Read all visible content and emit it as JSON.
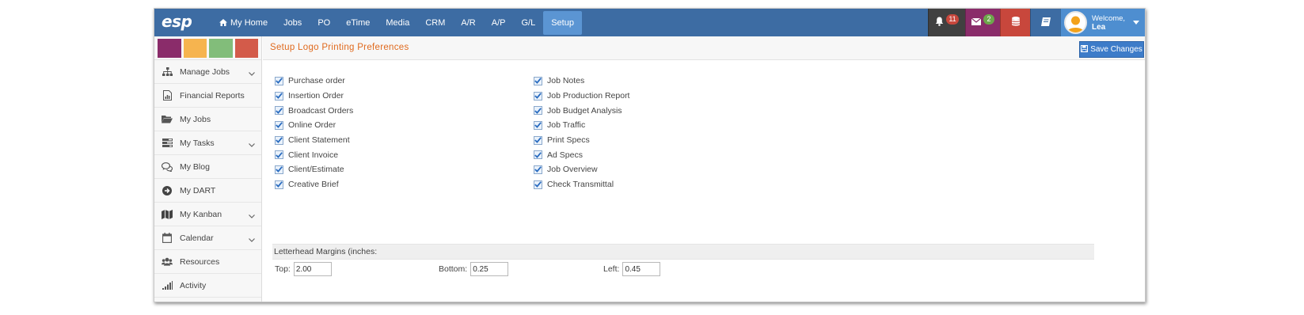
{
  "app": {
    "logo": "esp"
  },
  "nav": {
    "items": [
      {
        "label": "My Home"
      },
      {
        "label": "Jobs"
      },
      {
        "label": "PO"
      },
      {
        "label": "eTime"
      },
      {
        "label": "Media"
      },
      {
        "label": "CRM"
      },
      {
        "label": "A/R"
      },
      {
        "label": "A/P"
      },
      {
        "label": "G/L"
      },
      {
        "label": "Setup"
      }
    ],
    "active": "Setup"
  },
  "tools": {
    "notifications_count": "11",
    "messages_count": "2",
    "welcome": "Welcome,",
    "user_name": "Lea"
  },
  "colors": {
    "navbar": "#3d6ca3",
    "active_tab": "#5b95d3",
    "title": "#e06a1e",
    "swatches": [
      "#8a2c6a",
      "#f6b44f",
      "#82bd7a",
      "#d35b4a"
    ]
  },
  "sidebar": {
    "items": [
      {
        "label": "Manage Jobs",
        "icon": "sitemap-icon",
        "expandable": true
      },
      {
        "label": "Financial Reports",
        "icon": "report-icon",
        "expandable": false
      },
      {
        "label": "My Jobs",
        "icon": "folder-open-icon",
        "expandable": false
      },
      {
        "label": "My Tasks",
        "icon": "tasks-icon",
        "expandable": true
      },
      {
        "label": "My Blog",
        "icon": "comments-icon",
        "expandable": false
      },
      {
        "label": "My DART",
        "icon": "arrow-circle-icon",
        "expandable": false
      },
      {
        "label": "My Kanban",
        "icon": "map-icon",
        "expandable": true
      },
      {
        "label": "Calendar",
        "icon": "calendar-icon",
        "expandable": true
      },
      {
        "label": "Resources",
        "icon": "users-icon",
        "expandable": false
      },
      {
        "label": "Activity",
        "icon": "signal-icon",
        "expandable": false
      }
    ]
  },
  "page": {
    "title": "Setup Logo Printing Preferences",
    "save_label": "Save Changes"
  },
  "preferences": {
    "left": [
      {
        "label": "Purchase order",
        "checked": true
      },
      {
        "label": "Insertion Order",
        "checked": true
      },
      {
        "label": "Broadcast Orders",
        "checked": true
      },
      {
        "label": "Online Order",
        "checked": true
      },
      {
        "label": "Client Statement",
        "checked": true
      },
      {
        "label": "Client Invoice",
        "checked": true
      },
      {
        "label": "Client/Estimate",
        "checked": true
      },
      {
        "label": "Creative Brief",
        "checked": true
      }
    ],
    "right": [
      {
        "label": "Job Notes",
        "checked": true
      },
      {
        "label": "Job Production Report",
        "checked": true
      },
      {
        "label": "Job Budget Analysis",
        "checked": true
      },
      {
        "label": "Job Traffic",
        "checked": true
      },
      {
        "label": "Print Specs",
        "checked": true
      },
      {
        "label": "Ad Specs",
        "checked": true
      },
      {
        "label": "Job Overview",
        "checked": true
      },
      {
        "label": "Check Transmittal",
        "checked": true
      }
    ]
  },
  "margins": {
    "heading": "Letterhead Margins (inches:",
    "top_label": "Top:",
    "top_value": "2.00",
    "bottom_label": "Bottom:",
    "bottom_value": "0.25",
    "left_label": "Left:",
    "left_value": "0.45"
  }
}
